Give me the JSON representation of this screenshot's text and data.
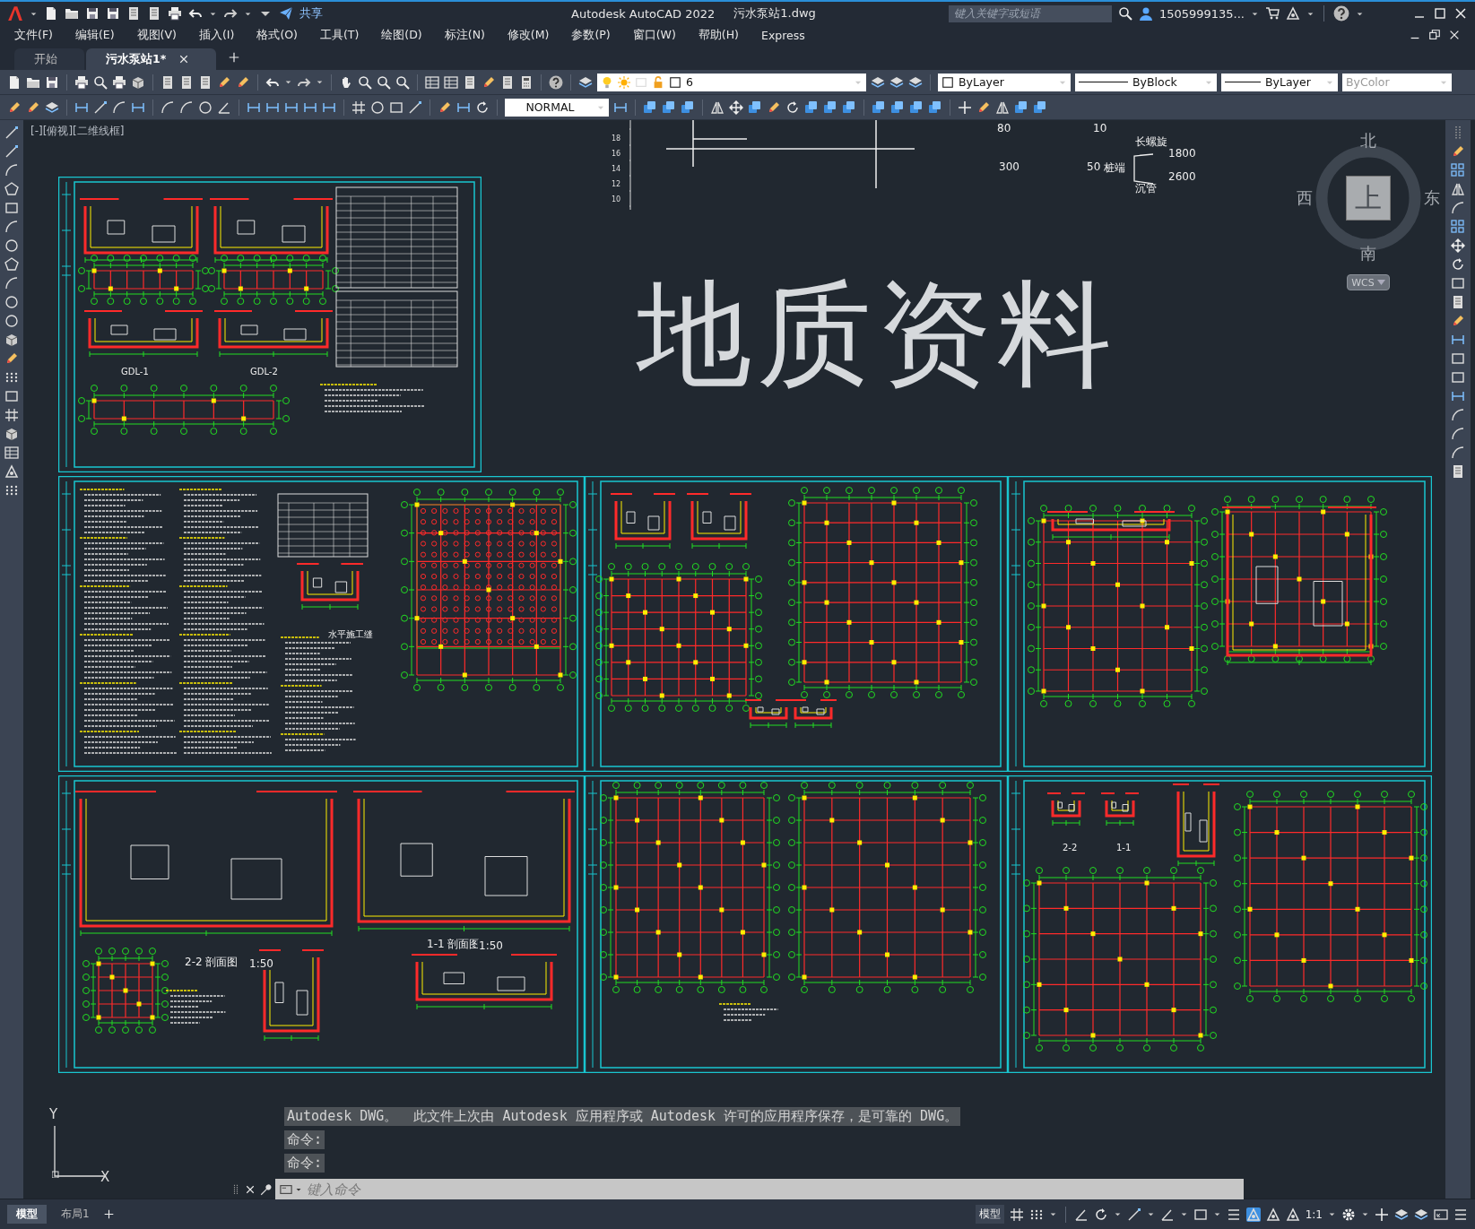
{
  "title_bar": {
    "share": "共享",
    "title": "Autodesk AutoCAD 2022",
    "file": "污水泵站1.dwg",
    "search": {
      "placeholder": "键入关键字或短语"
    },
    "user": "1505999135..."
  },
  "menu": [
    "文件(F)",
    "编辑(E)",
    "视图(V)",
    "插入(I)",
    "格式(O)",
    "工具(T)",
    "绘图(D)",
    "标注(N)",
    "修改(M)",
    "参数(P)",
    "窗口(W)",
    "帮助(H)",
    "Express"
  ],
  "tabs": [
    {
      "label": "开始",
      "selected": false
    },
    {
      "label": "污水泵站1*",
      "selected": true
    }
  ],
  "properties_toolbar": {
    "layer": "6",
    "color_setting": "ByLayer",
    "linetype": "ByBlock",
    "lineweight": "ByLayer",
    "plot_style": {
      "value": "ByColor",
      "disabled": true
    }
  },
  "dim_style": "NORMAL",
  "viewport_label": "[-][俯视][二维线框]",
  "ruler_numbers": [
    "18",
    "16",
    "14",
    "12",
    "10"
  ],
  "drawing_notes": [
    "80",
    "10",
    "300",
    "50",
    "桩端",
    "长螺旋",
    "1800",
    "2600",
    "沉管"
  ],
  "title_text": "地质资料",
  "viewcube": {
    "north": "北",
    "west": "西",
    "east": "东",
    "south": "南",
    "face": "上",
    "ucs_menu": "WCS"
  },
  "sheets": [
    {
      "kind": "beam-details",
      "labels": [
        "GDL-1",
        "GDL-2"
      ]
    },
    {
      "kind": "design-notes",
      "labels": [
        "水平施工缝"
      ]
    },
    {
      "kind": "pump-plan"
    },
    {
      "kind": "basement-plan"
    },
    {
      "kind": "sections",
      "labels": [
        "2-2 剖面图",
        "1:50",
        "1-1 剖面图",
        "1:50"
      ]
    },
    {
      "kind": "floor-plan"
    },
    {
      "kind": "column-plan",
      "labels": [
        "2-2",
        "1-1"
      ]
    }
  ],
  "ucs_icon": {
    "x": "X",
    "y": "Y"
  },
  "command_history": [
    "Autodesk DWG。  此文件上次由 Autodesk 应用程序或 Autodesk 许可的应用程序保存，是可靠的 DWG。",
    "命令:",
    "命令:"
  ],
  "command_input": {
    "placeholder": "键入命令"
  },
  "layout_tabs": [
    {
      "label": "模型",
      "selected": true
    },
    {
      "label": "布局1",
      "selected": false
    }
  ],
  "status_bar": {
    "space": "模型",
    "annotation_scale": "1:1"
  }
}
